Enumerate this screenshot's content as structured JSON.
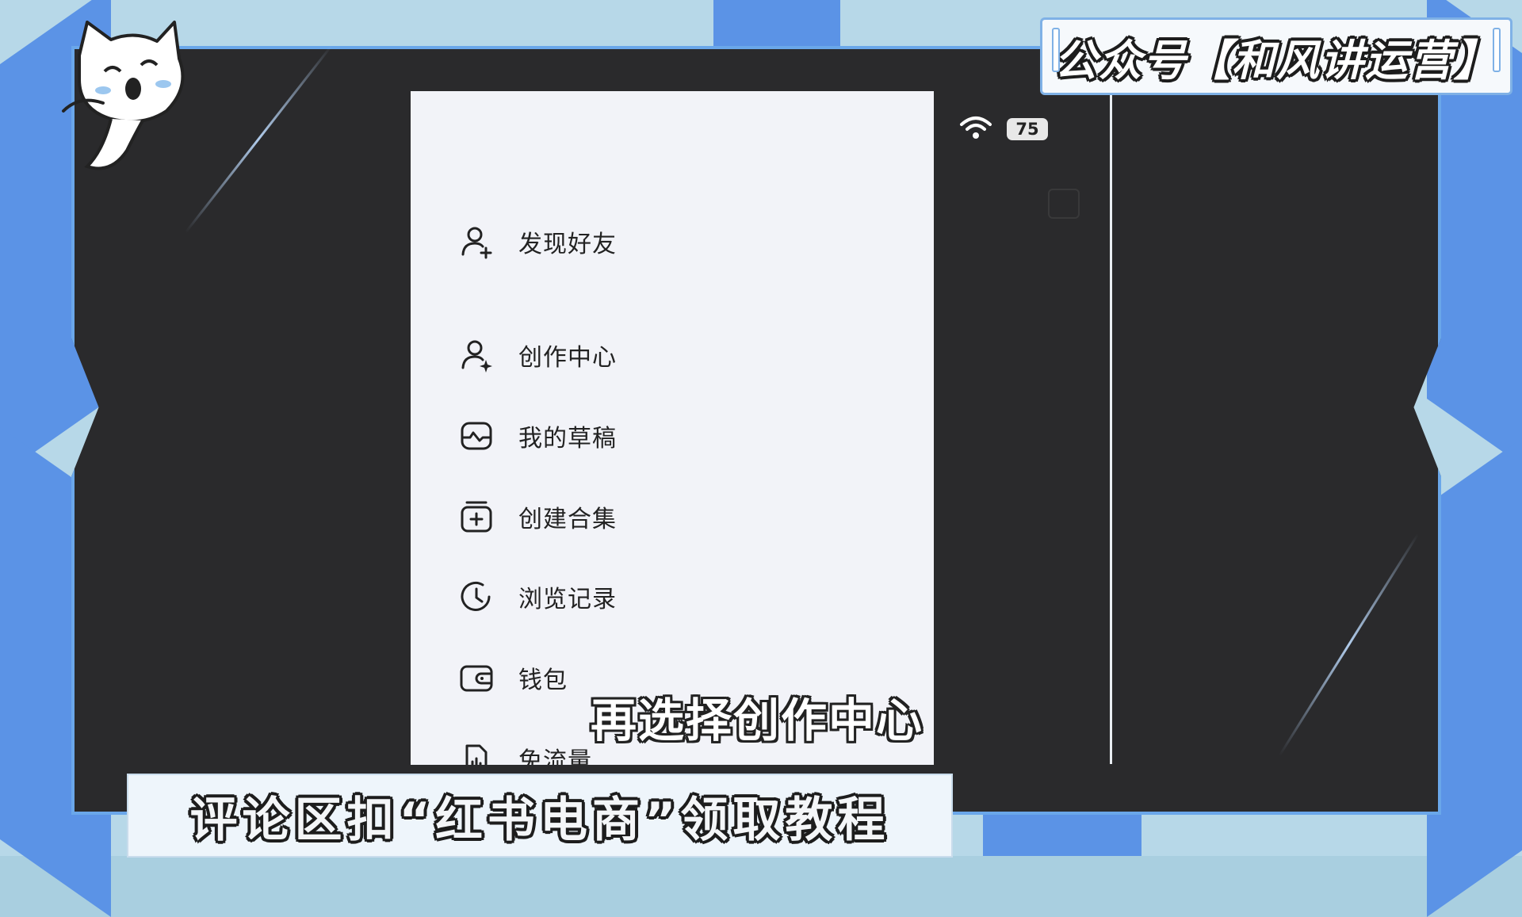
{
  "brand": {
    "text": "公众号【和风讲运营】"
  },
  "status_bar": {
    "battery": "75",
    "wifi_icon": "wifi-icon"
  },
  "menu": {
    "items": [
      {
        "label": "发现好友",
        "icon": "add-user-icon"
      },
      {
        "label": "创作中心",
        "icon": "creator-icon"
      },
      {
        "label": "我的草稿",
        "icon": "drafts-icon"
      },
      {
        "label": "创建合集",
        "icon": "add-collection-icon"
      },
      {
        "label": "浏览记录",
        "icon": "history-icon"
      },
      {
        "label": "钱包",
        "icon": "wallet-icon"
      },
      {
        "label": "免流量",
        "icon": "data-free-icon"
      }
    ]
  },
  "subtitle": "再选择创作中心",
  "banner": {
    "text": "评论区扣“红书电商”领取教程"
  },
  "colors": {
    "accent_blue": "#5b93e6",
    "screen_bg": "#2a2a2c",
    "panel_bg": "#f2f3f8"
  }
}
